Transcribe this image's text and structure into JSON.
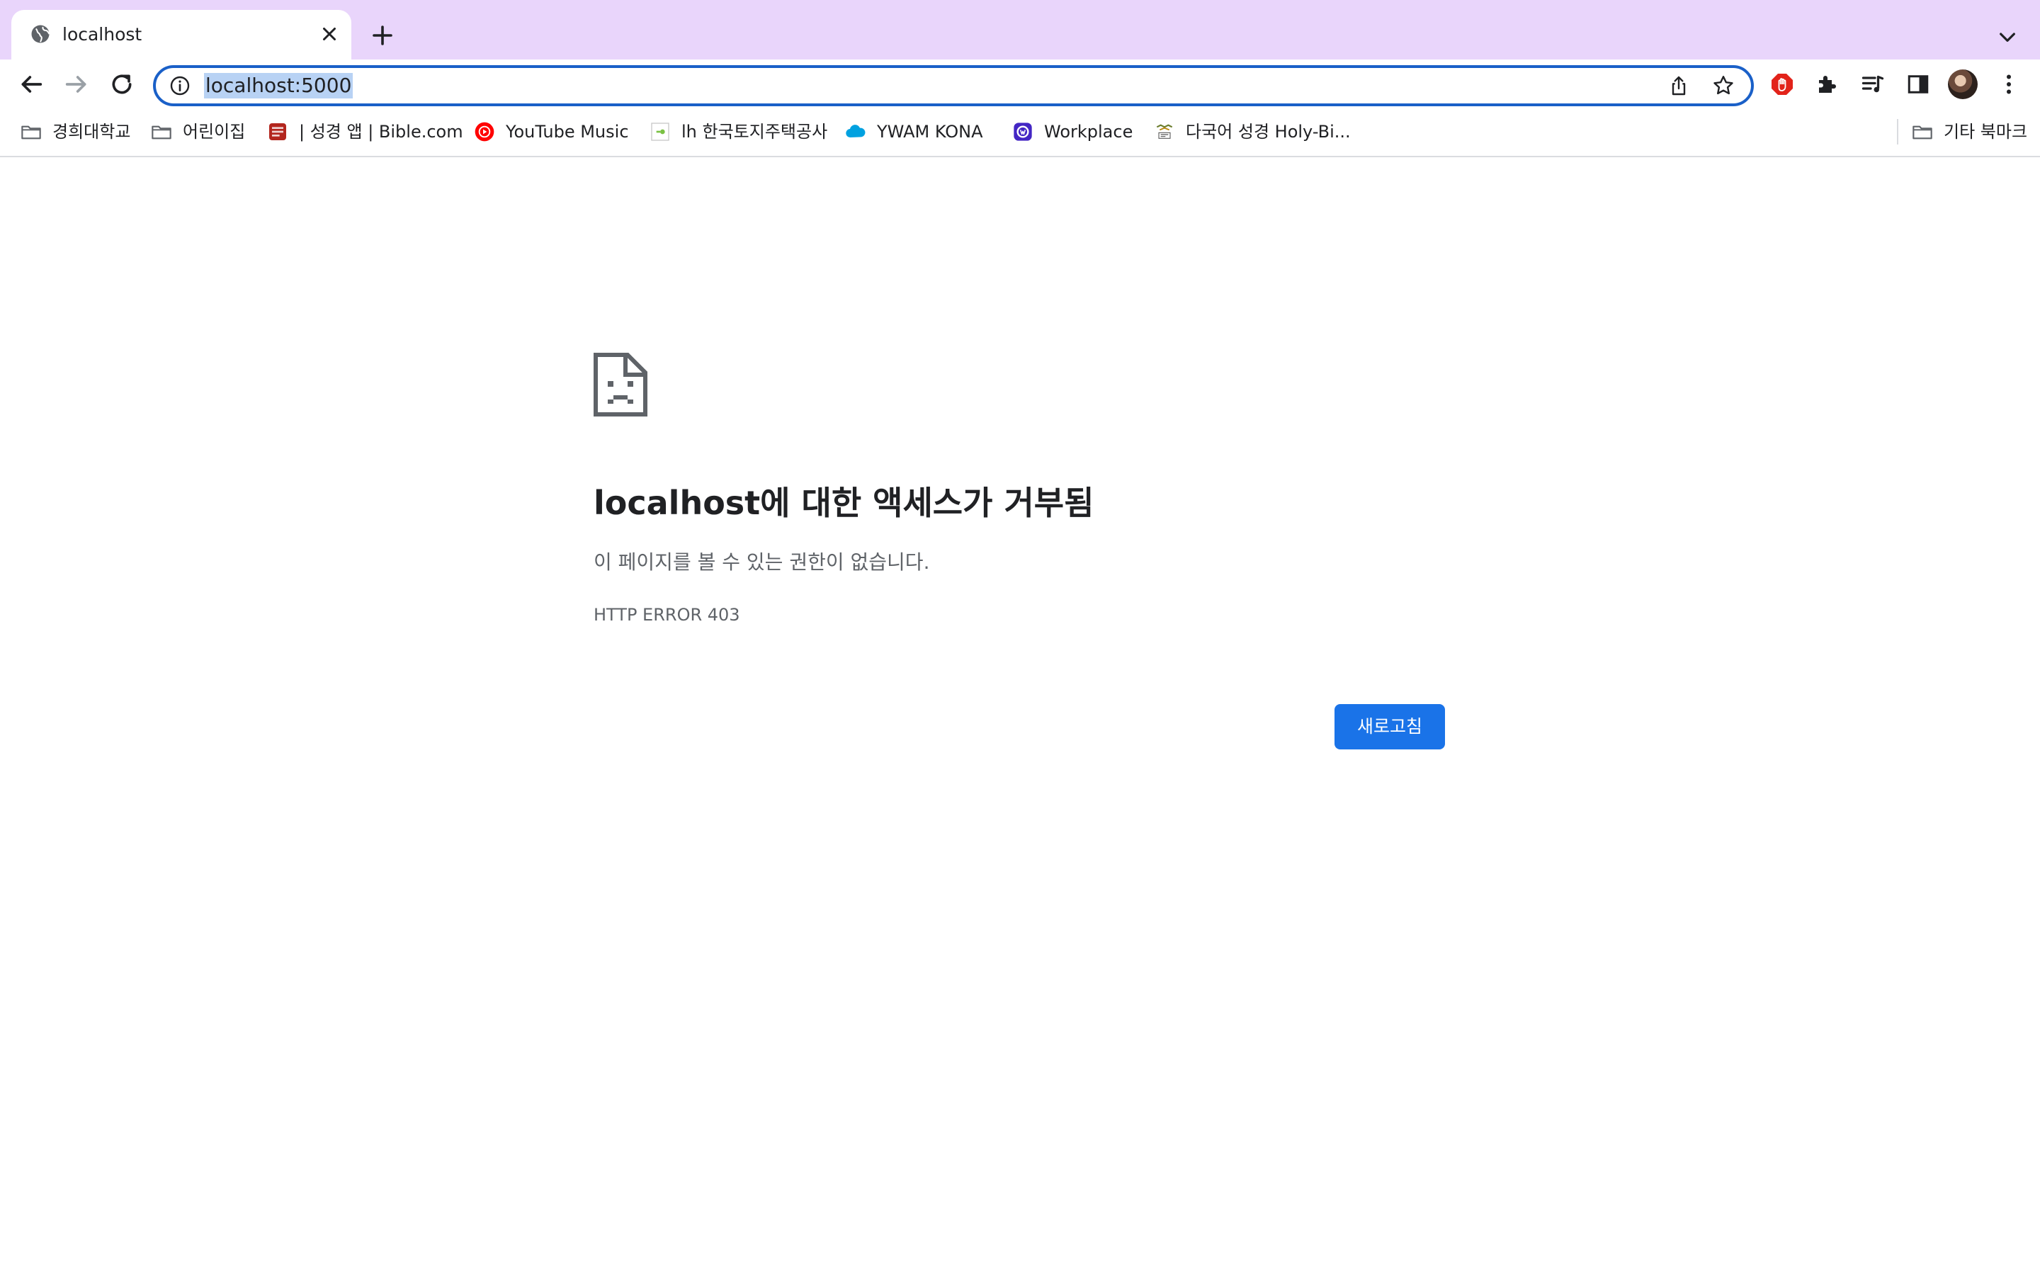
{
  "tab": {
    "title": "localhost",
    "icon": "globe-icon"
  },
  "omnibox": {
    "url": "localhost:5000"
  },
  "bookmarks": [
    {
      "label": "경희대학교",
      "icon": "folder-icon"
    },
    {
      "label": "어린이집",
      "icon": "folder-icon"
    },
    {
      "label": "| 성경 앱 | Bible.com",
      "icon": "bible-app-icon"
    },
    {
      "label": "YouTube Music",
      "icon": "youtube-music-icon"
    },
    {
      "label": "lh 한국토지주택공사",
      "icon": "lh-icon"
    },
    {
      "label": "YWAM KONA",
      "icon": "cloud-icon"
    },
    {
      "label": "Workplace",
      "icon": "workplace-icon"
    },
    {
      "label": "다국어 성경 Holy-Bi...",
      "icon": "holy-bible-icon"
    }
  ],
  "other_bookmarks": {
    "label": "기타 북마크",
    "icon": "folder-icon"
  },
  "error": {
    "title": "localhost에 대한 액세스가 거부됨",
    "message": "이 페이지를 볼 수 있는 권한이 없습니다.",
    "code": "HTTP ERROR 403",
    "reload_label": "새로고침"
  },
  "colors": {
    "tab_strip": "#e9d5fb",
    "accent": "#1a73e8",
    "omnibox_border": "#1a60c8",
    "selection": "#b8d2f4"
  }
}
